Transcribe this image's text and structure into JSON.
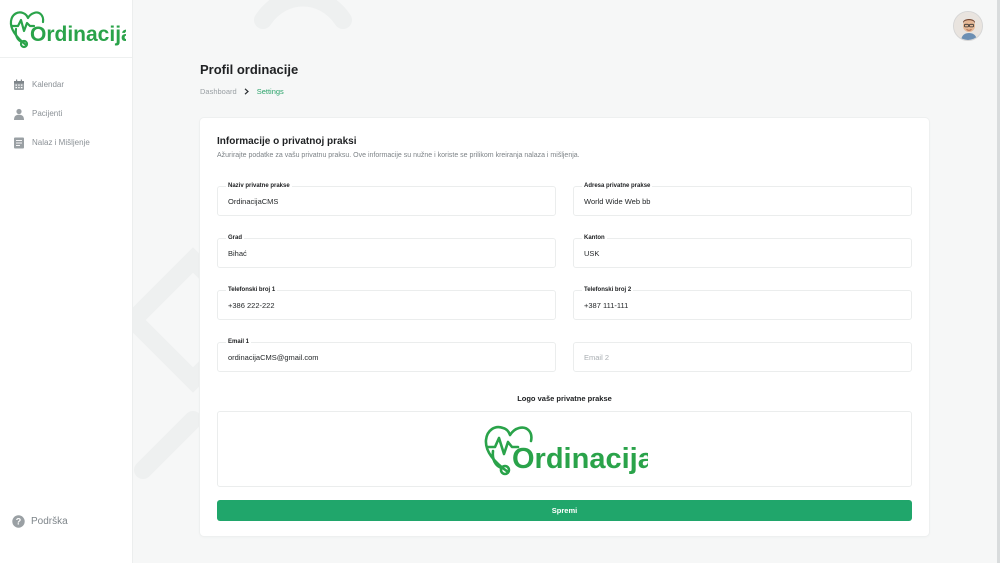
{
  "brand": {
    "logo_text": "Ordinacija",
    "color": "#2aa34a"
  },
  "sidebar": {
    "items": [
      {
        "label": "Kalendar",
        "icon": "calendar-icon"
      },
      {
        "label": "Pacijenti",
        "icon": "user-icon"
      },
      {
        "label": "Nalaz i Mišljenje",
        "icon": "document-icon"
      }
    ],
    "support": {
      "label": "Podrška",
      "icon": "help-circle-icon"
    }
  },
  "header": {
    "title": "Profil ordinacije",
    "breadcrumb": [
      "Dashboard",
      "Settings"
    ]
  },
  "form": {
    "title": "Informacije o privatnoj praksi",
    "description": "Ažurirajte podatke za vašu privatnu praksu. Ove informacije su nužne i koriste se prilikom kreiranja nalaza i mišljenja.",
    "fields": {
      "naziv": {
        "label": "Naziv privatne prakse",
        "value": "OrdinacijaCMS"
      },
      "adresa": {
        "label": "Adresa privatne prakse",
        "value": "World Wide Web bb"
      },
      "grad": {
        "label": "Grad",
        "value": "Bihać"
      },
      "kanton": {
        "label": "Kanton",
        "value": "USK"
      },
      "tel1": {
        "label": "Telefonski broj 1",
        "value": "+386 222-222"
      },
      "tel2": {
        "label": "Telefonski broj 2",
        "value": "+387 111-111"
      },
      "email1": {
        "label": "Email 1",
        "value": "ordinacijaCMS@gmail.com"
      },
      "email2": {
        "placeholder": "Email 2",
        "value": ""
      }
    },
    "logo_label": "Logo vaše privatne prakse",
    "logo_text": "Ordinacija",
    "save_label": "Spremi"
  },
  "colors": {
    "accent": "#20a66b",
    "breadcrumb_active": "#2aa36a",
    "sidebar_text": "#8b9196"
  }
}
